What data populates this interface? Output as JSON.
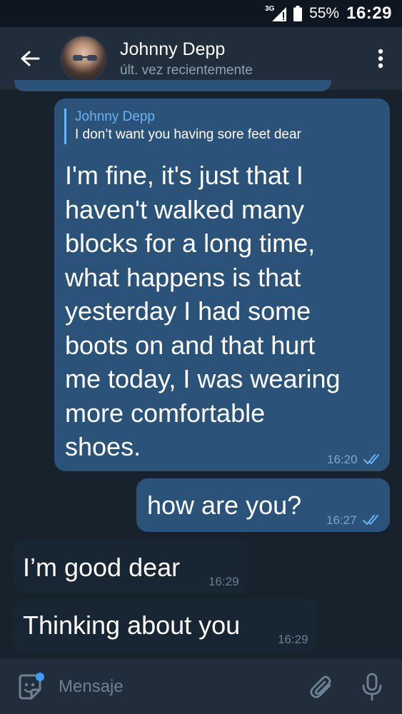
{
  "status_bar": {
    "network": "3G",
    "battery": "55%",
    "time": "16:29"
  },
  "header": {
    "name": "Johnny Depp",
    "status": "últ. vez recientemente"
  },
  "messages": [
    {
      "direction": "outgoing",
      "reply_to": {
        "name": "Johnny Depp",
        "text": "I don’t want you having sore feet dear"
      },
      "lines": [
        "I'm fine, it's just that I",
        "haven't walked many",
        "blocks for a long time,",
        "what happens is that",
        "yesterday I had some",
        "boots on and that hurt",
        "me today, I was wearing",
        "more comfortable",
        "shoes."
      ],
      "time": "16:20",
      "read": true
    },
    {
      "direction": "outgoing",
      "text": "how are you?",
      "time": "16:27",
      "read": true
    },
    {
      "direction": "incoming",
      "text": "I’m good dear",
      "time": "16:29"
    },
    {
      "direction": "incoming",
      "text": "Thinking about you",
      "time": "16:29"
    }
  ],
  "input": {
    "placeholder": "Mensaje"
  },
  "colors": {
    "background": "#18222d",
    "header": "#212d3b",
    "outgoing_bubble": "#2b5278",
    "incoming_bubble": "#182533",
    "accent": "#6ab3f3",
    "sticker_dot": "#3d9df2"
  },
  "icons": {
    "back": "arrow-left-icon",
    "menu": "more-vertical-icon",
    "sticker": "sticker-icon",
    "attach": "paperclip-icon",
    "mic": "microphone-icon",
    "read": "double-check-icon"
  }
}
